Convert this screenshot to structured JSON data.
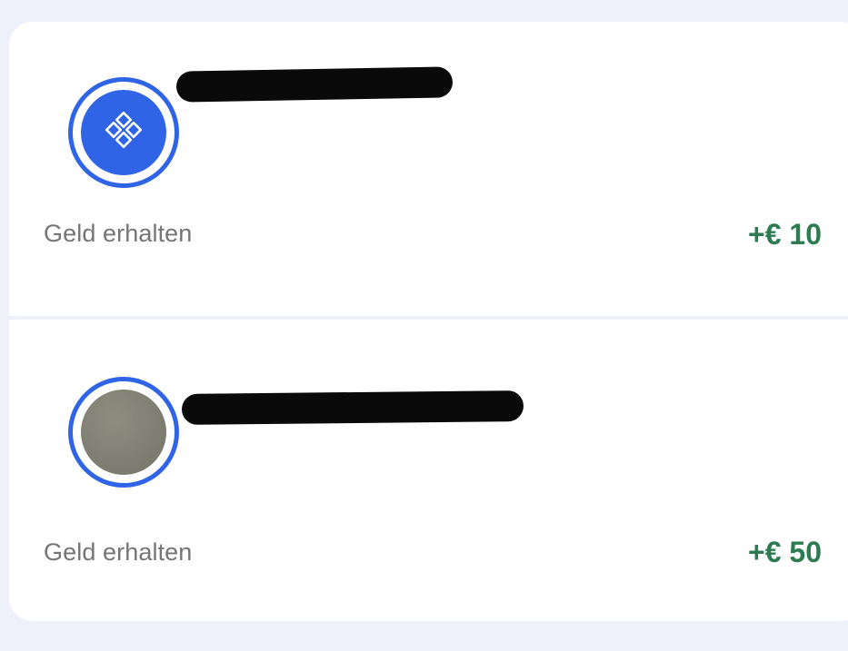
{
  "colors": {
    "accent": "#2f64e6",
    "positive_amount": "#2e7b52",
    "label_text": "#757575",
    "page_bg": "#eef1f9",
    "card_bg": "#ffffff"
  },
  "transactions": [
    {
      "avatar": "diamond-grid-icon",
      "sender_name_redacted": true,
      "description": "Geld erhalten",
      "amount": "+€ 10"
    },
    {
      "avatar": "profile-photo",
      "sender_name_redacted": true,
      "description": "Geld erhalten",
      "amount": "+€ 50"
    }
  ]
}
